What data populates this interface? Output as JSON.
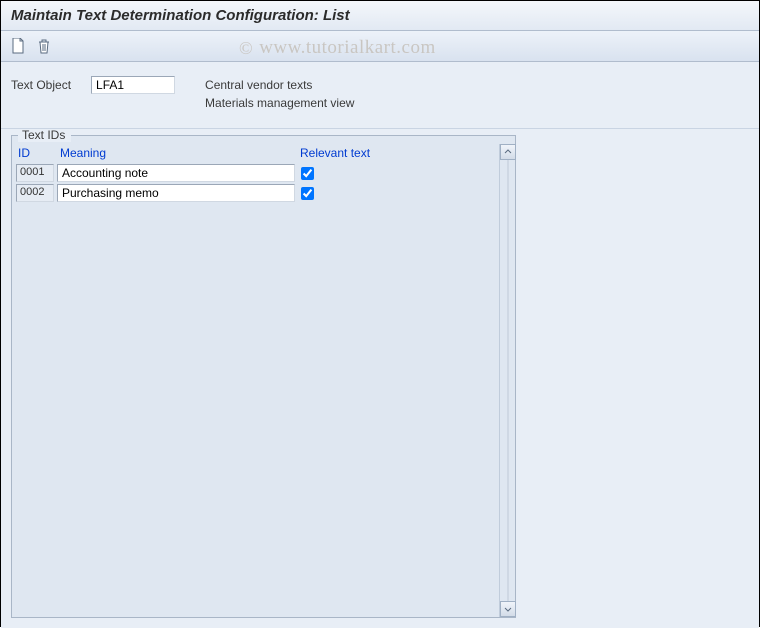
{
  "title": "Maintain Text Determination Configuration: List",
  "toolbar": {
    "new_tooltip": "Create",
    "delete_tooltip": "Delete"
  },
  "header": {
    "text_object_label": "Text Object",
    "text_object_value": "LFA1",
    "desc1": "Central vendor texts",
    "desc2": "Materials management view"
  },
  "group": {
    "title": "Text IDs",
    "columns": {
      "id": "ID",
      "meaning": "Meaning",
      "relevant": "Relevant text"
    },
    "rows": [
      {
        "id": "0001",
        "meaning": "Accounting note",
        "relevant": true
      },
      {
        "id": "0002",
        "meaning": "Purchasing memo",
        "relevant": true
      }
    ]
  },
  "watermark": "www.tutorialkart.com"
}
